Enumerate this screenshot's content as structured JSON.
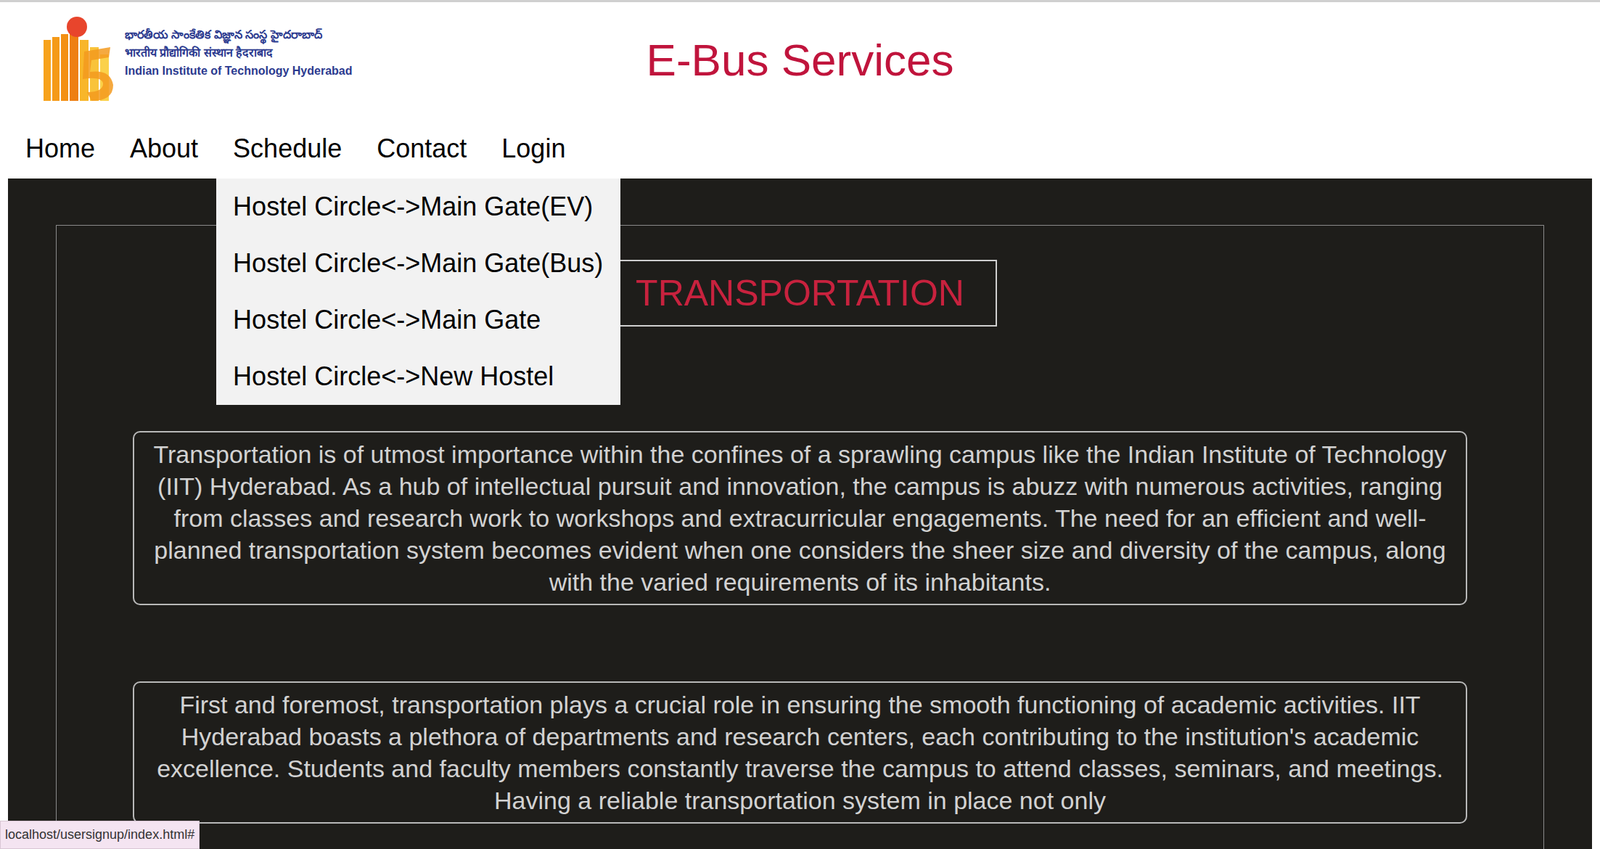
{
  "logo": {
    "lines": [
      "భారతీయ సాంకేతిక విజ్ఞాన సంస్థ హైదరాబాద్",
      "भारतीय प्रौद्योगिकी संस्थान हैदराबाद",
      "Indian Institute of Technology Hyderabad"
    ]
  },
  "title": "E-Bus Services",
  "nav": [
    {
      "label": "Home",
      "expanded": false
    },
    {
      "label": "About",
      "expanded": false
    },
    {
      "label": "Schedule",
      "expanded": true,
      "items": [
        "Hostel Circle<->Main Gate(EV)",
        "Hostel Circle<->Main Gate(Bus)",
        "Hostel Circle<->Main Gate",
        "Hostel Circle<->New Hostel"
      ]
    },
    {
      "label": "Contact",
      "expanded": false
    },
    {
      "label": "Login",
      "expanded": false
    }
  ],
  "hero": {
    "heading": "TRANSPORTATION",
    "paragraphs": [
      "Transportation is of utmost importance within the confines of a sprawling campus like the Indian Institute of Technology (IIT) Hyderabad. As a hub of intellectual pursuit and innovation, the campus is abuzz with numerous activities, ranging from classes and research work to workshops and extracurricular engagements. The need for an efficient and well-planned transportation system becomes evident when one considers the sheer size and diversity of the campus, along with the varied requirements of its inhabitants.",
      "First and foremost, transportation plays a crucial role in ensuring the smooth functioning of academic activities. IIT Hyderabad boasts a plethora of departments and research centers, each contributing to the institution's academic excellence. Students and faculty members constantly traverse the campus to attend classes, seminars, and meetings. Having a reliable transportation system in place not only"
    ]
  },
  "status_bar": "localhost/usersignup/index.html#"
}
